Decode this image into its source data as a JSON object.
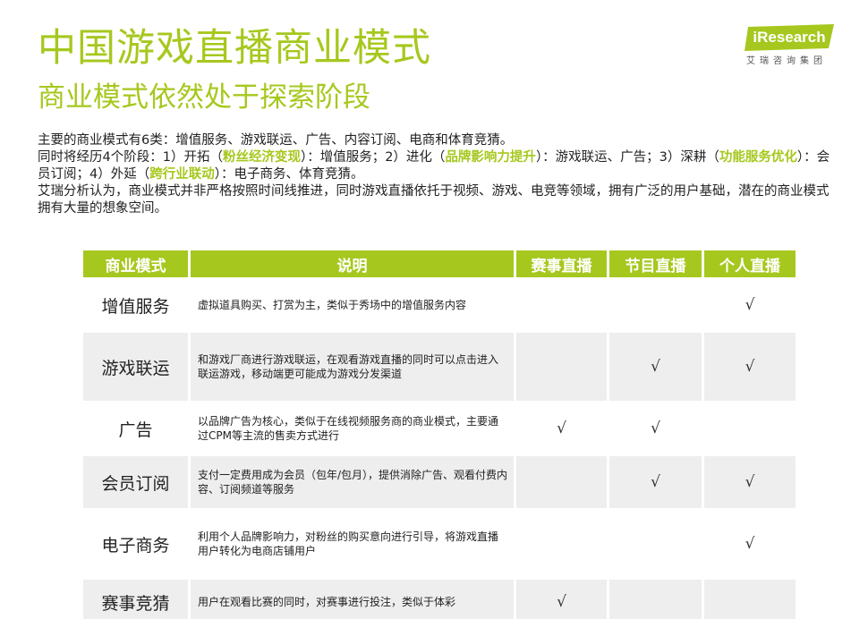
{
  "header": {
    "title": "中国游戏直播商业模式",
    "subtitle": "商业模式依然处于探索阶段"
  },
  "logo": {
    "brand": "iResearch",
    "chinese": "艾瑞咨询集团"
  },
  "intro": {
    "line1": "主要的商业模式有6类：增值服务、游戏联运、广告、内容订阅、电商和体育竞猜。",
    "line2_a": "同时将经历4个阶段：1）开拓（",
    "line2_hl1": "粉丝经济变现",
    "line2_b": "）：增值服务；2）进化（",
    "line2_hl2": "品牌影响力提升",
    "line2_c": "）：游戏联运、广告；3）深耕（",
    "line2_hl3": "功能服务优化",
    "line2_d": "）：会员订阅；4）外延（",
    "line2_hl4": "跨行业联动",
    "line2_e": "）：电子商务、体育竞猜。",
    "line3": "艾瑞分析认为，商业模式并非严格按照时间线推进，同时游戏直播依托于视频、游戏、电竞等领域，拥有广泛的用户基础，潜在的商业模式拥有大量的想象空间。"
  },
  "table": {
    "headers": [
      "商业模式",
      "说明",
      "赛事直播",
      "节目直播",
      "个人直播"
    ],
    "rows": [
      {
        "name": "增值服务",
        "desc": "虚拟道具购买、打赏为主，类似于秀场中的增值服务内容",
        "event": "",
        "program": "",
        "personal": "√"
      },
      {
        "name": "游戏联运",
        "desc": "和游戏厂商进行游戏联运，在观看游戏直播的同时可以点击进入联运游戏，移动端更可能成为游戏分发渠道",
        "event": "",
        "program": "√",
        "personal": "√"
      },
      {
        "name": "广告",
        "desc": "以品牌广告为核心，类似于在线视频服务商的商业模式，主要通过CPM等主流的售卖方式进行",
        "event": "√",
        "program": "√",
        "personal": ""
      },
      {
        "name": "会员订阅",
        "desc": "支付一定费用成为会员（包年/包月），提供消除广告、观看付费内容、订阅频道等服务",
        "event": "",
        "program": "√",
        "personal": "√"
      },
      {
        "name": "电子商务",
        "desc": "利用个人品牌影响力，对粉丝的购买意向进行引导，将游戏直播用户转化为电商店铺用户",
        "event": "",
        "program": "",
        "personal": "√"
      },
      {
        "name": "赛事竞猜",
        "desc": "用户在观看比赛的同时，对赛事进行投注，类似于体彩",
        "event": "√",
        "program": "",
        "personal": ""
      }
    ]
  },
  "colors": {
    "accent": "#a6c81e",
    "row_alt": "#eeeeee"
  }
}
